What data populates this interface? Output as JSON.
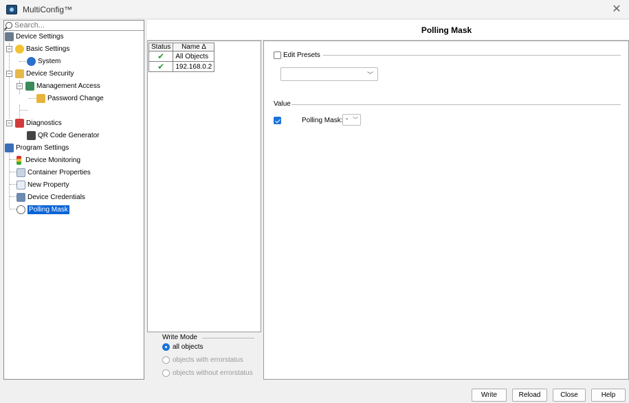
{
  "window": {
    "title": "MultiConfig™"
  },
  "search": {
    "placeholder": "Search..."
  },
  "tree": {
    "device_settings": "Device Settings",
    "basic_settings": "Basic Settings",
    "system": "System",
    "device_security": "Device Security",
    "management_access": "Management Access",
    "password_change": "Password Change",
    "diagnostics": "Diagnostics",
    "qr_code_generator": "QR Code Generator",
    "program_settings": "Program Settings",
    "device_monitoring": "Device Monitoring",
    "container_properties": "Container Properties",
    "new_property": "New Property",
    "device_credentials": "Device Credentials",
    "polling_mask": "Polling Mask"
  },
  "header": {
    "title": "Polling Mask"
  },
  "status_table": {
    "columns": [
      "Status",
      "Name ∆"
    ],
    "rows": [
      {
        "status": "✔",
        "name": "All Objects"
      },
      {
        "status": "✔",
        "name": "192.168.0.2"
      }
    ]
  },
  "write_mode": {
    "title": "Write Mode",
    "options": [
      "all objects",
      "objects with errorstatus",
      "objects without errorstatus"
    ]
  },
  "right": {
    "edit_presets": "Edit Presets",
    "value_label": "Value",
    "polling_mask_label": "Polling Mask:",
    "polling_mask_value": "-"
  },
  "buttons": {
    "write": "Write",
    "reload": "Reload",
    "close": "Close",
    "help": "Help"
  },
  "colors": {
    "selection": "#0a64d6",
    "check": "#2e9a2e",
    "accent": "#1a73d9"
  }
}
